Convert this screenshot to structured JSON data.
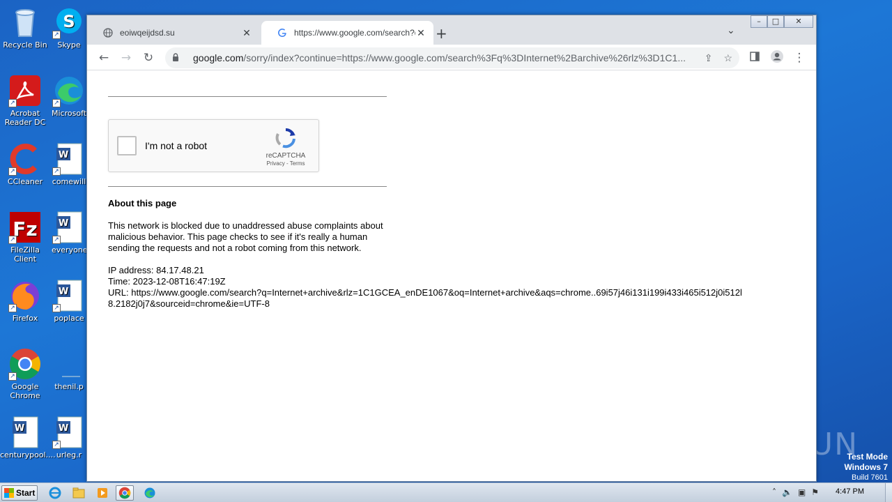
{
  "desktop": {
    "icons": [
      {
        "label": "Recycle Bin",
        "icon": "recycle-bin-icon"
      },
      {
        "label": "Skype",
        "icon": "skype-icon"
      },
      {
        "label": "Acrobat Reader DC",
        "icon": "acrobat-icon"
      },
      {
        "label": "Microsoft",
        "icon": "edge-icon"
      },
      {
        "label": "CCleaner",
        "icon": "ccleaner-icon"
      },
      {
        "label": "comewill",
        "icon": "word-doc-icon"
      },
      {
        "label": "FileZilla Client",
        "icon": "filezilla-icon"
      },
      {
        "label": "everyone",
        "icon": "word-doc-icon"
      },
      {
        "label": "Firefox",
        "icon": "firefox-icon"
      },
      {
        "label": "poplace",
        "icon": "word-doc-icon"
      },
      {
        "label": "Google Chrome",
        "icon": "chrome-icon"
      },
      {
        "label": "thenil.p",
        "icon": "file-icon"
      },
      {
        "label": "centurypool....",
        "icon": "word-doc-icon"
      },
      {
        "label": "urleg.r",
        "icon": "word-doc-icon"
      }
    ],
    "watermark": "ANY RUN",
    "test_mode": {
      "line1": "Test Mode",
      "line2": "Windows 7",
      "line3": "Build 7601"
    }
  },
  "browser": {
    "tabs": [
      {
        "title": "eoiwqeijdsd.su",
        "active": false
      },
      {
        "title": "https://www.google.com/search?q=",
        "active": true
      }
    ],
    "new_tab": "+",
    "address": {
      "host": "google.com",
      "path": "/sorry/index?continue=https://www.google.com/search%3Fq%3DInternet%2Barchive%26rlz%3D1C1..."
    }
  },
  "page": {
    "captcha": {
      "label": "I'm not a robot",
      "brand": "reCAPTCHA",
      "links": "Privacy - Terms"
    },
    "about_title": "About this page",
    "paragraph": "This network is blocked due to unaddressed abuse complaints about malicious behavior. This page checks to see if it's really a human sending the requests and not a robot coming from this network.",
    "ip": "IP address: 84.17.48.21",
    "time": "Time: 2023-12-08T16:47:19Z",
    "url": "URL: https://www.google.com/search?q=Internet+archive&rlz=1C1GCEA_enDE1067&oq=Internet+archive&aqs=chrome..69i57j46i131i199i433i465i512j0i512l8.2182j0j7&sourceid=chrome&ie=UTF-8"
  },
  "taskbar": {
    "start_label": "Start",
    "clock": "4:47 PM"
  },
  "colors": {
    "desktop_bg": "#1d77d6",
    "recaptcha_blue": "#4a90e2",
    "recaptcha_gray": "#aaaaaa"
  }
}
